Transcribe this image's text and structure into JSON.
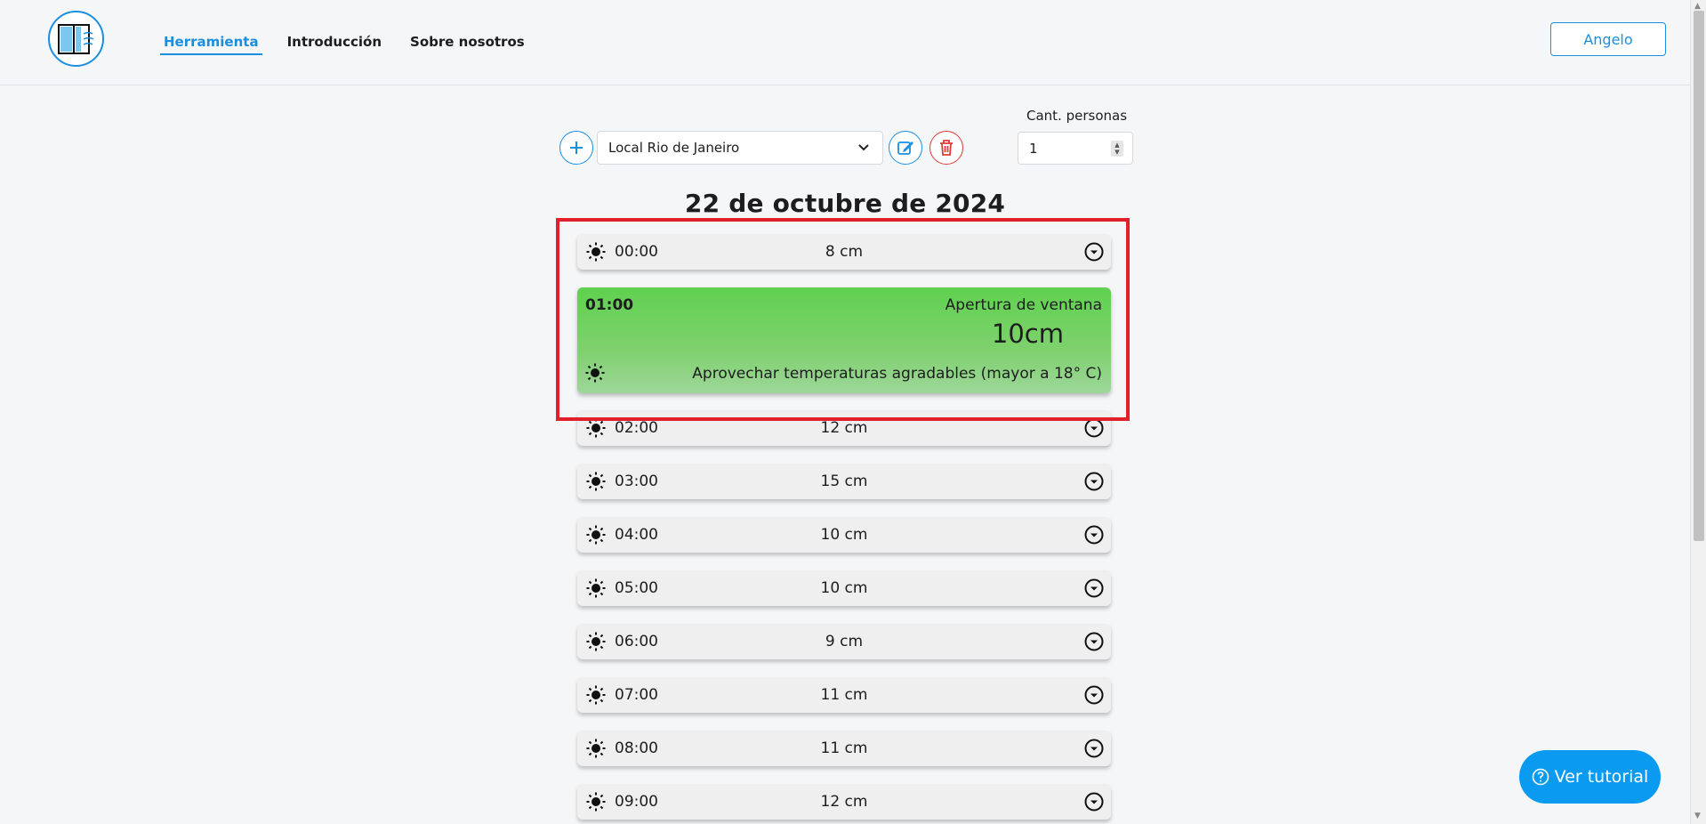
{
  "nav": {
    "items": [
      {
        "label": "Herramienta",
        "active": true
      },
      {
        "label": "Introducción",
        "active": false
      },
      {
        "label": "Sobre nosotros",
        "active": false
      }
    ],
    "user_label": "Angelo"
  },
  "controls": {
    "location_selected": "Local Rio de Janeiro",
    "persons_label": "Cant. personas",
    "persons_value": "1"
  },
  "date_title": "22 de octubre de 2024",
  "rows_before": [
    {
      "time": "00:00",
      "value": "8 cm"
    }
  ],
  "expanded": {
    "time": "01:00",
    "label": "Apertura de ventana",
    "value": "10cm",
    "description": "Aprovechar temperaturas agradables (mayor a 18° C)"
  },
  "rows_after": [
    {
      "time": "02:00",
      "value": "12 cm"
    },
    {
      "time": "03:00",
      "value": "15 cm"
    },
    {
      "time": "04:00",
      "value": "10 cm"
    },
    {
      "time": "05:00",
      "value": "10 cm"
    },
    {
      "time": "06:00",
      "value": "9 cm"
    },
    {
      "time": "07:00",
      "value": "11 cm"
    },
    {
      "time": "08:00",
      "value": "11 cm"
    },
    {
      "time": "09:00",
      "value": "12 cm"
    }
  ],
  "tutorial_label": "Ver tutorial",
  "colors": {
    "accent": "#1a8fe0",
    "danger": "#e03a3a",
    "card_green": "#5fd14f",
    "highlight_red": "#e0202a",
    "tutorial_blue": "#0a9bf0"
  },
  "icons": {
    "row_icon": "sun-icon",
    "row_action": "chevron-down-icon"
  }
}
